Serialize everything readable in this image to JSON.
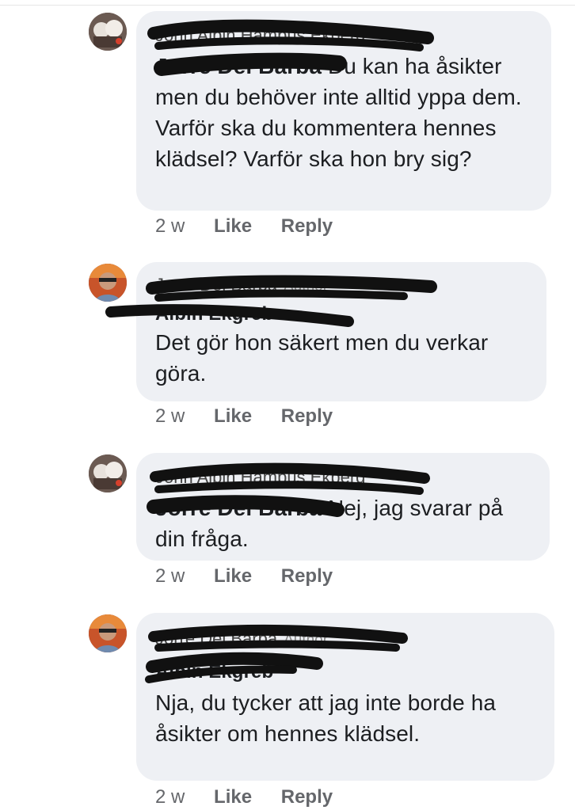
{
  "comments": [
    {
      "author": "John Albin Hampus Ekberg",
      "author_tag": "",
      "mention": "Jorre Del Barba",
      "text": "Du kan ha åsikter men du behöver inte alltid yppa dem. Varför ska du kommentera hennes klädsel? Varför ska hon bry sig?",
      "time": "2 w",
      "like_label": "Like",
      "reply_label": "Reply"
    },
    {
      "author": "Jorre Del Barba",
      "author_tag": "Author",
      "mention": "Albin Ekgreb",
      "text": "Det gör hon säkert men du verkar göra.",
      "time": "2 w",
      "like_label": "Like",
      "reply_label": "Reply"
    },
    {
      "author": "John Albin Hampus Ekberg",
      "author_tag": "",
      "mention": "Jorre Del Barba",
      "text": "Nej, jag svarar på din fråga.",
      "time": "2 w",
      "like_label": "Like",
      "reply_label": "Reply"
    },
    {
      "author": "Jorre Del Barba",
      "author_tag": "Author",
      "mention": "Albin Ekgreb",
      "text": "Nja, du tycker att jag inte borde ha åsikter om hennes klädsel.",
      "time": "2 w",
      "like_label": "Like",
      "reply_label": "Reply"
    }
  ],
  "colors": {
    "bubble": "#eef0f4",
    "meta_text": "#65676b",
    "scribble": "#111111"
  }
}
